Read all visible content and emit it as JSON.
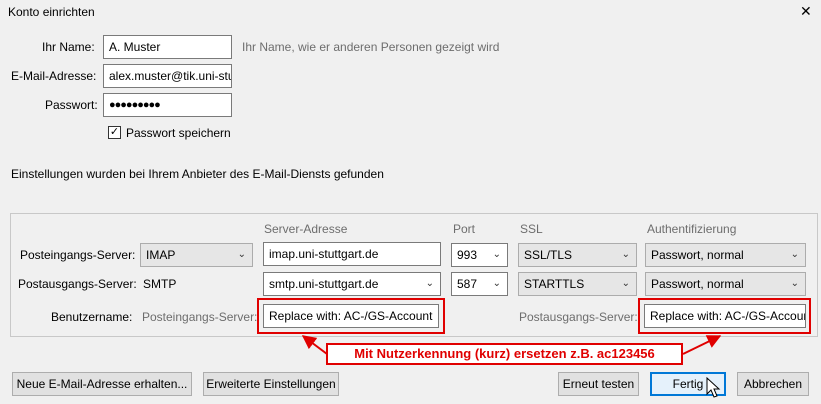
{
  "window": {
    "title": "Konto einrichten",
    "close_glyph": "✕"
  },
  "form": {
    "name_label": "Ihr Name:",
    "name_value": "A. Muster",
    "name_hint": "Ihr Name, wie er anderen Personen gezeigt wird",
    "email_label": "E-Mail-Adresse:",
    "email_value": "alex.muster@tik.uni-stuttgart.de",
    "password_label": "Passwort:",
    "password_value": "●●●●●●●●●",
    "save_password_label": "Passwort speichern",
    "save_password_checked": true
  },
  "found_message": "Einstellungen wurden bei Ihrem Anbieter des E-Mail-Diensts gefunden",
  "server": {
    "headers": {
      "address": "Server-Adresse",
      "port": "Port",
      "ssl": "SSL",
      "auth": "Authentifizierung"
    },
    "incoming": {
      "label": "Posteingangs-Server:",
      "protocol": "IMAP",
      "address": "imap.uni-stuttgart.de",
      "port": "993",
      "ssl": "SSL/TLS",
      "auth": "Passwort, normal"
    },
    "outgoing": {
      "label": "Postausgangs-Server:",
      "protocol": "SMTP",
      "address": "smtp.uni-stuttgart.de",
      "port": "587",
      "ssl": "STARTTLS",
      "auth": "Passwort, normal"
    },
    "username": {
      "label": "Benutzername:",
      "incoming_label": "Posteingangs-Server:",
      "incoming_value": "Replace with: AC-/GS-Account",
      "outgoing_label": "Postausgangs-Server:",
      "outgoing_value": "Replace with: AC-/GS-Account"
    }
  },
  "annotation": {
    "text": "Mit Nutzerkennung (kurz) ersetzen z.B. ac123456",
    "color": "#e00000"
  },
  "buttons": {
    "new_address": "Neue E-Mail-Adresse erhalten...",
    "advanced": "Erweiterte Einstellungen",
    "retest": "Erneut testen",
    "done": "Fertig",
    "cancel": "Abbrechen"
  }
}
